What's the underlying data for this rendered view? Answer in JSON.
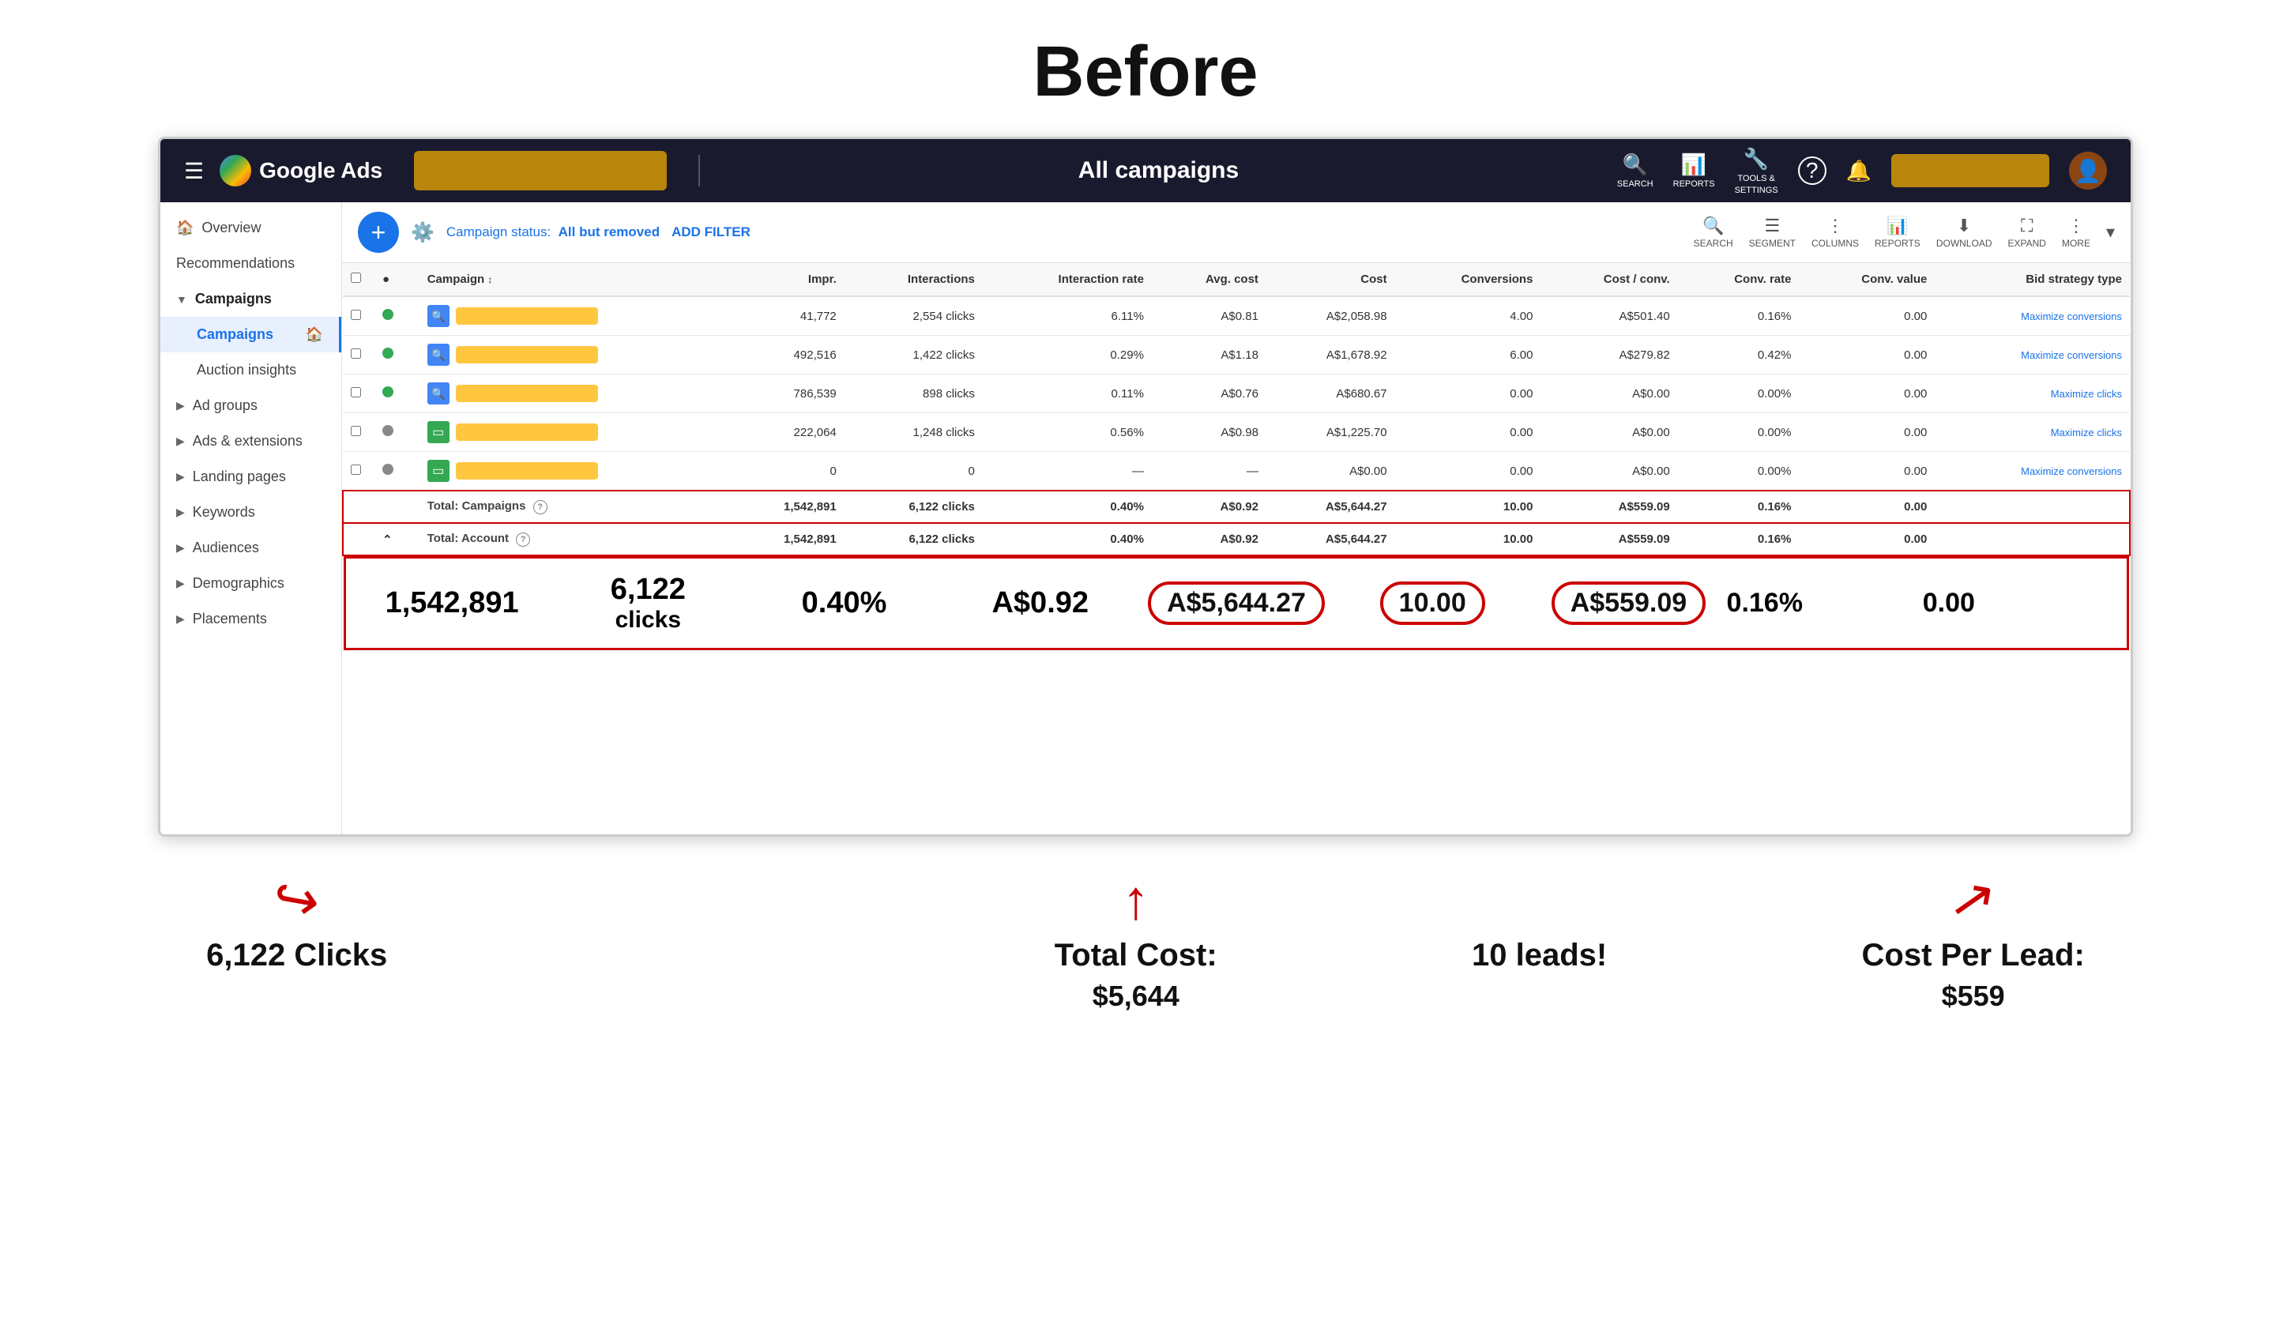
{
  "page": {
    "title": "Before"
  },
  "topNav": {
    "appName": "Google Ads",
    "pageName": "All campaigns",
    "icons": [
      {
        "name": "search-icon",
        "label": "SEARCH",
        "symbol": "🔍"
      },
      {
        "name": "reports-icon",
        "label": "REPORTS",
        "symbol": "📊"
      },
      {
        "name": "tools-icon",
        "label": "TOOLS & SETTINGS",
        "symbol": "🔧"
      },
      {
        "name": "help-icon",
        "label": "",
        "symbol": "?"
      },
      {
        "name": "notifications-icon",
        "label": "",
        "symbol": "🔔"
      }
    ]
  },
  "sidebar": {
    "items": [
      {
        "id": "overview",
        "label": "Overview",
        "hasIcon": true,
        "active": false
      },
      {
        "id": "recommendations",
        "label": "Recommendations",
        "hasIcon": false,
        "active": false
      },
      {
        "id": "campaigns-header",
        "label": "Campaigns",
        "hasArrow": true,
        "active": false
      },
      {
        "id": "campaigns",
        "label": "Campaigns",
        "hasIcon": true,
        "active": true
      },
      {
        "id": "auction-insights",
        "label": "Auction insights",
        "hasIcon": false,
        "active": false
      },
      {
        "id": "ad-groups",
        "label": "Ad groups",
        "hasArrow": true,
        "active": false
      },
      {
        "id": "ads-extensions",
        "label": "Ads & extensions",
        "hasArrow": true,
        "active": false
      },
      {
        "id": "landing-pages",
        "label": "Landing pages",
        "hasArrow": true,
        "active": false
      },
      {
        "id": "keywords",
        "label": "Keywords",
        "hasArrow": true,
        "active": false
      },
      {
        "id": "audiences",
        "label": "Audiences",
        "hasArrow": true,
        "active": false
      },
      {
        "id": "demographics",
        "label": "Demographics",
        "hasArrow": true,
        "active": false
      },
      {
        "id": "placements",
        "label": "Placements",
        "hasArrow": true,
        "active": false
      }
    ]
  },
  "toolbar": {
    "addButton": "+",
    "filterStatus": "Campaign status:",
    "filterValue": "All but removed",
    "addFilter": "ADD FILTER",
    "icons": [
      {
        "id": "search",
        "label": "SEARCH",
        "symbol": "🔍"
      },
      {
        "id": "segment",
        "label": "SEGMENT",
        "symbol": "☰"
      },
      {
        "id": "columns",
        "label": "COLUMNS",
        "symbol": "⋮"
      },
      {
        "id": "reports",
        "label": "REPORTS",
        "symbol": "📊"
      },
      {
        "id": "download",
        "label": "DOWNLOAD",
        "symbol": "⬇"
      },
      {
        "id": "expand",
        "label": "EXPAND",
        "symbol": "⛶"
      },
      {
        "id": "more",
        "label": "MORE",
        "symbol": "⋮"
      }
    ]
  },
  "table": {
    "columns": [
      "",
      "",
      "Campaign",
      "Impr.",
      "Interactions",
      "Interaction rate",
      "Avg. cost",
      "Cost",
      "Conversions",
      "Cost / conv.",
      "Conv. rate",
      "Conv. value",
      "Bid strategy type"
    ],
    "rows": [
      {
        "id": 1,
        "iconType": "search",
        "nameBlurred": true,
        "impr": "41,772",
        "interactions": "2,554 clicks",
        "intRate": "6.11%",
        "avgCost": "A$0.81",
        "cost": "A$2,058.98",
        "conversions": "4.00",
        "costConv": "A$501.40",
        "convRate": "0.16%",
        "convValue": "0.00",
        "bidStrategy": "Maximize conversions"
      },
      {
        "id": 2,
        "iconType": "search",
        "nameBlurred": true,
        "impr": "492,516",
        "interactions": "1,422 clicks",
        "intRate": "0.29%",
        "avgCost": "A$1.18",
        "cost": "A$1,678.92",
        "conversions": "6.00",
        "costConv": "A$279.82",
        "convRate": "0.42%",
        "convValue": "0.00",
        "bidStrategy": "Maximize conversions"
      },
      {
        "id": 3,
        "iconType": "search",
        "nameBlurred": true,
        "impr": "786,539",
        "interactions": "898 clicks",
        "intRate": "0.11%",
        "avgCost": "A$0.76",
        "cost": "A$680.67",
        "conversions": "0.00",
        "costConv": "A$0.00",
        "convRate": "0.00%",
        "convValue": "0.00",
        "bidStrategy": "Maximize clicks"
      },
      {
        "id": 4,
        "iconType": "display",
        "nameBlurred": true,
        "impr": "222,064",
        "interactions": "1,248 clicks",
        "intRate": "0.56%",
        "avgCost": "A$0.98",
        "cost": "A$1,225.70",
        "conversions": "0.00",
        "costConv": "A$0.00",
        "convRate": "0.00%",
        "convValue": "0.00",
        "bidStrategy": "Maximize clicks"
      },
      {
        "id": 5,
        "iconType": "display",
        "nameBlurred": true,
        "impr": "0",
        "interactions": "0",
        "intRate": "—",
        "avgCost": "—",
        "cost": "A$0.00",
        "conversions": "0.00",
        "costConv": "A$0.00",
        "convRate": "0.00%",
        "convValue": "0.00",
        "bidStrategy": "Maximize conversions"
      }
    ],
    "totalCampaigns": {
      "label": "Total: Campaigns",
      "impr": "1,542,891",
      "interactions": "6,122 clicks",
      "intRate": "0.40%",
      "avgCost": "A$0.92",
      "cost": "A$5,644.27",
      "conversions": "10.00",
      "costConv": "A$559.09",
      "convRate": "0.16%",
      "convValue": "0.00"
    },
    "totalAccount": {
      "label": "Total: Account",
      "impr": "1,542,891",
      "interactions": "6,122 clicks",
      "intRate": "0.40%",
      "avgCost": "A$0.92",
      "cost": "A$5,644.27",
      "conversions": "10.00",
      "costConv": "A$559.09",
      "convRate": "0.16%",
      "convValue": "0.00"
    }
  },
  "annotations": {
    "clicks": {
      "value": "1,542,891",
      "clickCount": "6,122",
      "label": "6,122 Clicks"
    },
    "totalCost": {
      "value": "A$5,644.27",
      "label": "Total Cost:",
      "sublabel": "$5,644"
    },
    "leads": {
      "value": "10.00",
      "label": "10 leads!"
    },
    "costPerLead": {
      "value": "A$559.09",
      "label": "Cost Per Lead:",
      "sublabel": "$559"
    }
  }
}
